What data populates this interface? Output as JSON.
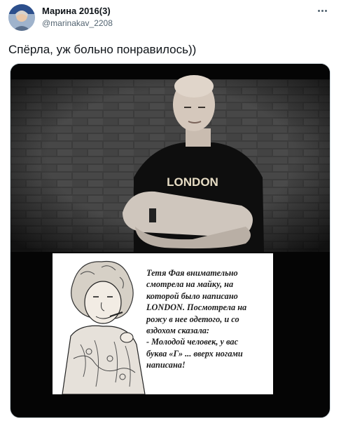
{
  "tweet": {
    "author": {
      "display_name": "Марина 2016(3)",
      "handle": "@marinakav_2208",
      "avatar_icon": "profile-avatar"
    },
    "more_icon": "more-options-icon",
    "text": "Спёрла, уж больно понравилось))",
    "media": {
      "shirt_text": "LONDON",
      "card_text": "Тетя Фая внимательно\nсмотрела на майку, на\nкоторой было написано\nLONDON. Посмотрела на\nрожу в нее одетого, и со\nвздохом сказала:\n- Молодой человек, у вас\nбуква «Г» ... вверх ногами\nнаписана!"
    }
  },
  "colors": {
    "text_primary": "#0f1419",
    "text_secondary": "#536471",
    "media_background": "#050505"
  }
}
